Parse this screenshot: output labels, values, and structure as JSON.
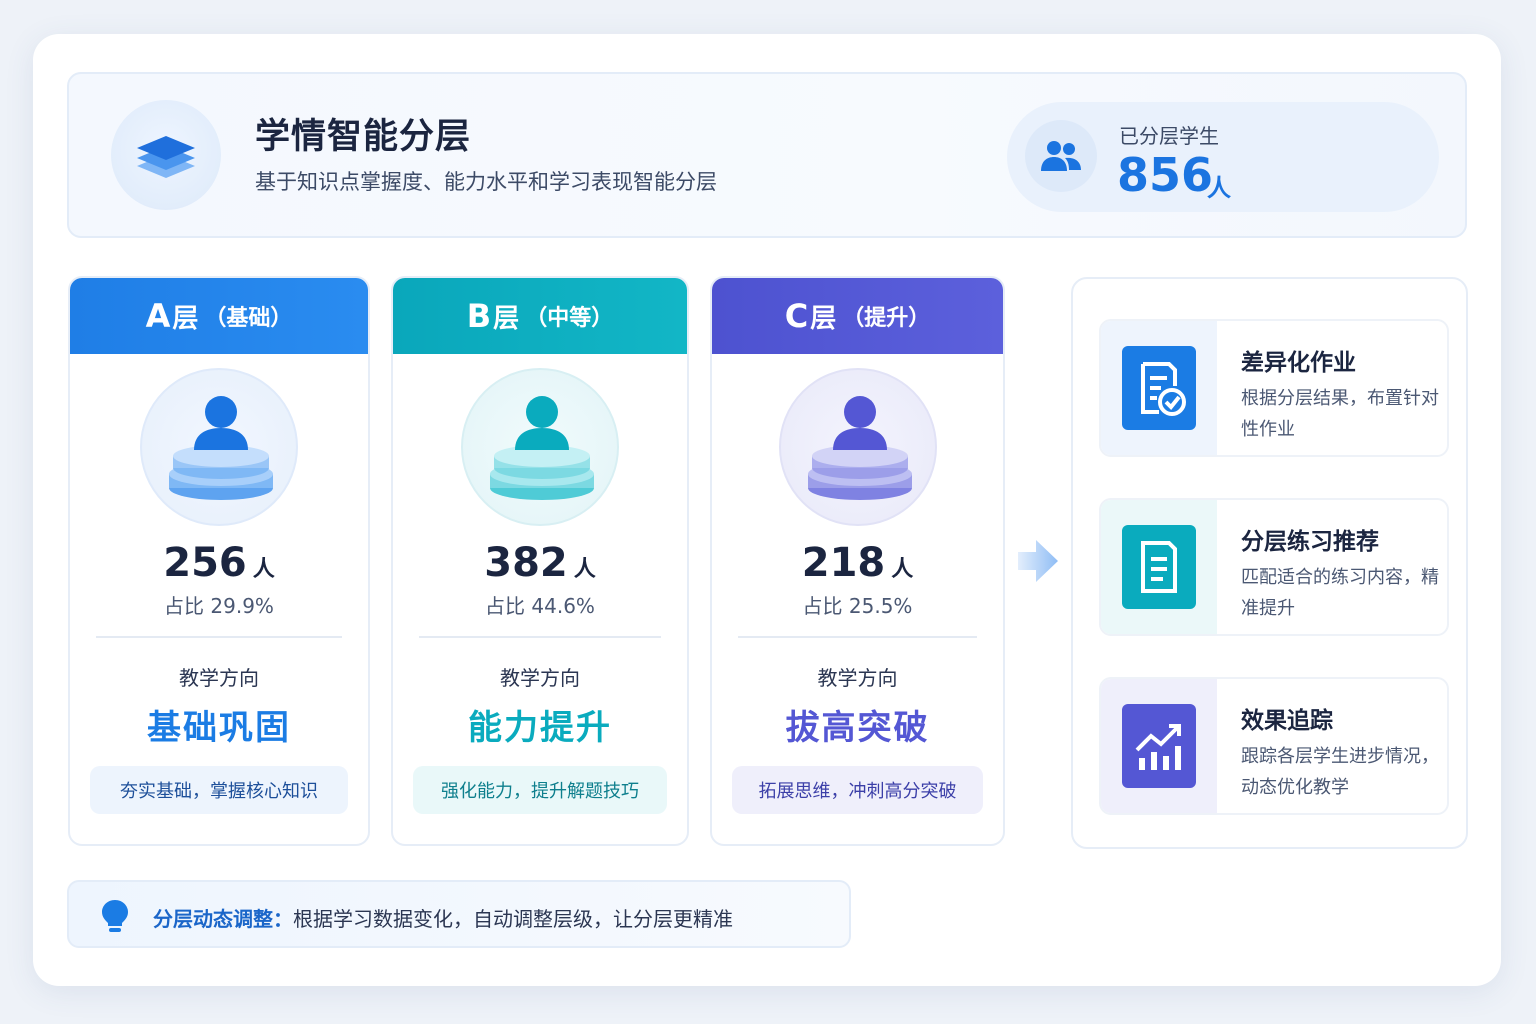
{
  "header": {
    "title": "学情智能分层",
    "subtitle": "基于知识点掌握度、能力水平和学习表现智能分层",
    "logo_icon": "layers-icon",
    "stat": {
      "label": "已分层学生",
      "value": "856",
      "unit": "人",
      "icon": "users-icon"
    }
  },
  "tiers": [
    {
      "letter": "A",
      "layer": "层",
      "paren": "（基础）",
      "count": "256",
      "unit": "人",
      "ratio": "占比 29.9%",
      "ratio_value": 29.9,
      "direction_label": "教学方向",
      "direction": "基础巩固",
      "tag": "夯实基础，掌握核心知识",
      "color": "#1b7ce4"
    },
    {
      "letter": "B",
      "layer": "层",
      "paren": "（中等）",
      "count": "382",
      "unit": "人",
      "ratio": "占比 44.6%",
      "ratio_value": 44.6,
      "direction_label": "教学方向",
      "direction": "能力提升",
      "tag": "强化能力，提升解题技巧",
      "color": "#0aabbe"
    },
    {
      "letter": "C",
      "layer": "层",
      "paren": "（提升）",
      "count": "218",
      "unit": "人",
      "ratio": "占比 25.5%",
      "ratio_value": 25.5,
      "direction_label": "教学方向",
      "direction": "拔高突破",
      "tag": "拓展思维，冲刺高分突破",
      "color": "#5457d4"
    }
  ],
  "features": [
    {
      "title": "差异化作业",
      "desc": "根据分层结果，布置针对性作业",
      "icon": "assignment-check-icon",
      "color": "#1b7ce4"
    },
    {
      "title": "分层练习推荐",
      "desc": "匹配适合的练习内容，精准提升",
      "icon": "document-list-icon",
      "color": "#0aabbe"
    },
    {
      "title": "效果追踪",
      "desc": "跟踪各层学生进步情况，动态优化教学",
      "icon": "trend-chart-icon",
      "color": "#5457d4"
    }
  ],
  "tip": {
    "icon": "lightbulb-icon",
    "strong": "分层动态调整：",
    "text": "根据学习数据变化，自动调整层级，让分层更精准"
  }
}
